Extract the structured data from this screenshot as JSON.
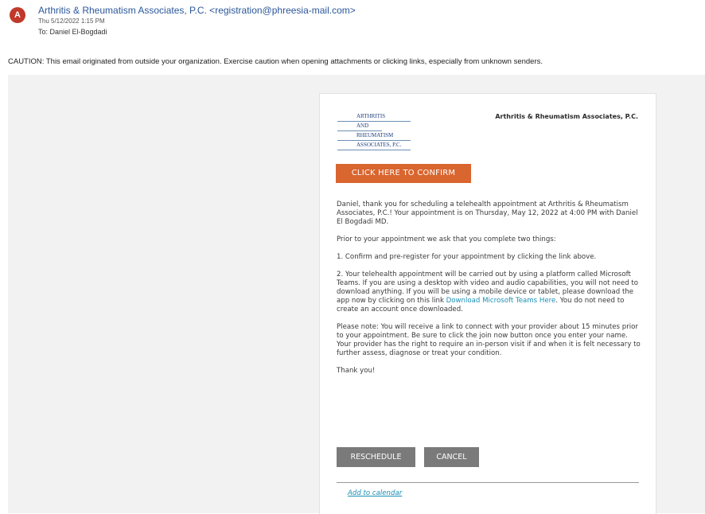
{
  "header": {
    "avatar_letter": "A",
    "sender": "Arthritis & Rheumatism Associates, P.C. <registration@phreesia-mail.com>",
    "sent_date": "Thu 5/12/2022 1:15 PM",
    "to": "To:  Daniel El-Bogdadi"
  },
  "caution": "CAUTION: This email originated from outside your organization. Exercise caution when opening attachments or clicking links, especially from unknown senders.",
  "email": {
    "logo_lines": [
      "ARTHRITIS",
      "AND",
      "RHEUMATISM",
      "ASSOCIATES, P.C."
    ],
    "practice_name": "Arthritis & Rheumatism Associates, P.C.",
    "confirm_label": "CLICK HERE TO CONFIRM",
    "para1": "Daniel, thank you for scheduling a telehealth appointment at Arthritis & Rheumatism Associates, P.C.!  Your appointment is on Thursday, May 12, 2022 at 4:00 PM with Daniel El Bogdadi MD.",
    "para2": "Prior to your appointment we ask that you complete two things:",
    "para3": "1. Confirm and pre-register for your appointment by clicking the link above.",
    "para4_before": "2. Your telehealth appointment will be carried out by using a platform called Microsoft Teams. If you are using a desktop with video and audio capabilities, you will not need to download anything.  If you will be using a mobile device or tablet, please download the app now by clicking on this link ",
    "para4_link": "Download Microsoft Teams Here",
    "para4_after": ". You do not need to create an account once downloaded.",
    "para5": "Please note: You will receive a link to connect with your provider about 15 minutes prior to your appointment.  Be sure to click the join now button once you enter your name. Your provider has the right to require an in-person visit if and when it is felt necessary to further assess, diagnose or treat your condition.",
    "thanks": "Thank you!",
    "reschedule_label": "RESCHEDULE",
    "cancel_label": "CANCEL",
    "calendar_label": "Add to calendar"
  },
  "colors": {
    "avatar": "#c0392b",
    "sender_link": "#2b579a",
    "confirm_button": "#d9652f",
    "gray_button": "#7a7a7a",
    "link": "#1a8fb4",
    "background_panel": "#f2f2f2"
  }
}
